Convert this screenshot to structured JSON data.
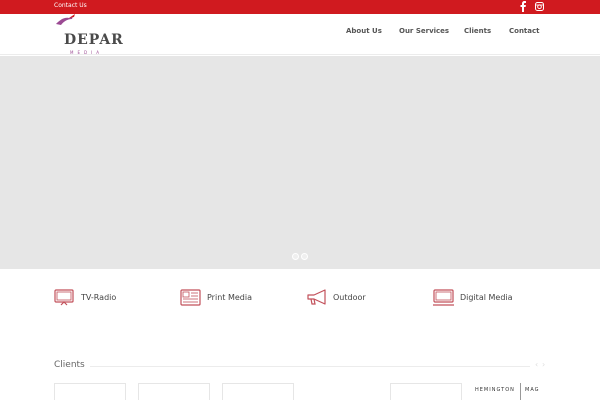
{
  "topbar": {
    "contact_label": "Contact Us",
    "icons": [
      "facebook-icon",
      "instagram-icon"
    ]
  },
  "brand": {
    "logo_text": "DEPAR",
    "logo_subtext": "MEDIA"
  },
  "nav": {
    "about": "About Us",
    "services": "Our Services",
    "clients": "Clients",
    "contact": "Contact"
  },
  "slider": {
    "slide_count": 2,
    "active_slide": 1
  },
  "services": [
    {
      "label": "TV-Radio",
      "icon": "tv-icon"
    },
    {
      "label": "Print Media",
      "icon": "newspaper-icon"
    },
    {
      "label": "Outdoor",
      "icon": "megaphone-icon"
    },
    {
      "label": "Digital Media",
      "icon": "monitor-icon"
    }
  ],
  "clients": {
    "title": "Clients",
    "brand_1": "HEMINGTON",
    "brand_2": "MAG"
  },
  "colors": {
    "accent": "#d01a1f",
    "logo_purple": "#9b4a93",
    "hero_bg": "#e6e6e6"
  }
}
